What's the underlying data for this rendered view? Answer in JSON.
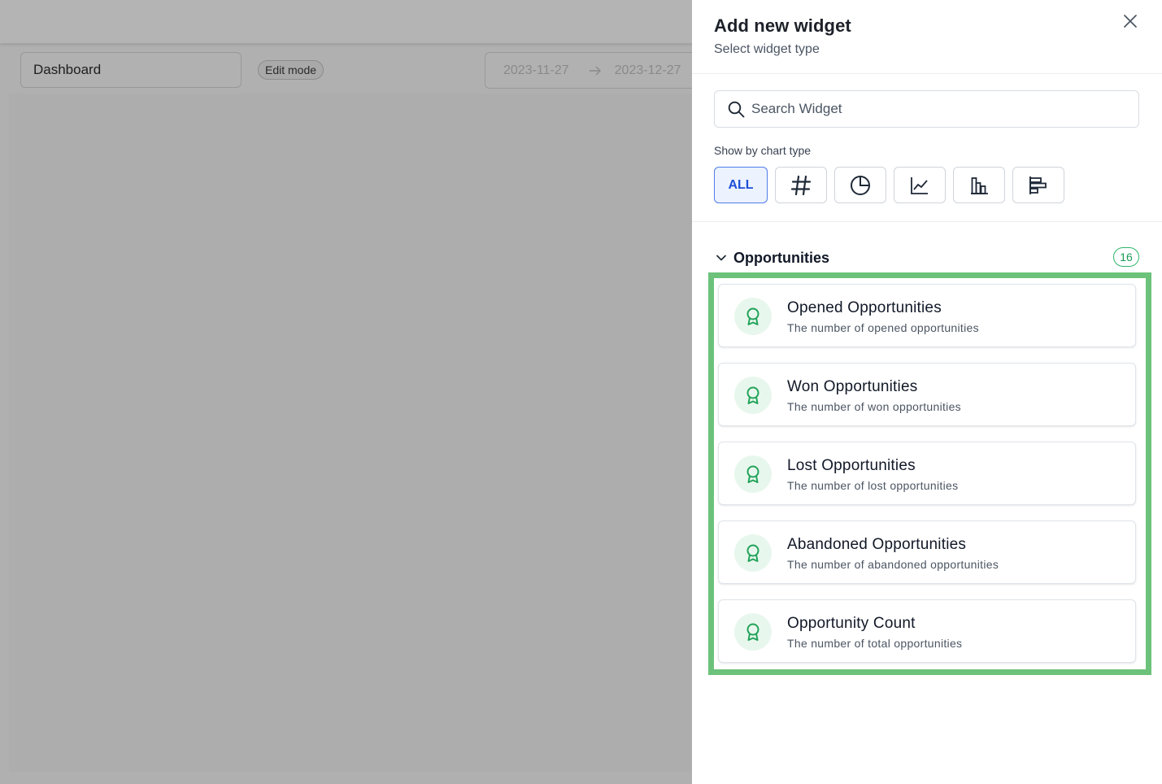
{
  "background": {
    "dashboard_select": "Dashboard",
    "edit_mode_badge": "Edit mode",
    "date_start": "2023-11-27",
    "date_end": "2023-12-27"
  },
  "drawer": {
    "title": "Add new widget",
    "subtitle": "Select widget type",
    "close_icon": "close-icon",
    "search": {
      "placeholder": "Search Widget",
      "value": "",
      "icon": "search-icon"
    },
    "filter_label": "Show by chart type",
    "filters": [
      {
        "label": "ALL",
        "icon": null,
        "active": true
      },
      {
        "label": "",
        "icon": "hash-icon",
        "active": false
      },
      {
        "label": "",
        "icon": "pie-chart-icon",
        "active": false
      },
      {
        "label": "",
        "icon": "line-chart-icon",
        "active": false
      },
      {
        "label": "",
        "icon": "bar-chart-icon",
        "active": false
      },
      {
        "label": "",
        "icon": "horizontal-bar-chart-icon",
        "active": false
      }
    ],
    "group": {
      "title": "Opportunities",
      "count": "16",
      "expanded": true,
      "items": [
        {
          "title": "Opened Opportunities",
          "description": "The number of opened opportunities",
          "icon": "award-icon"
        },
        {
          "title": "Won Opportunities",
          "description": "The number of won opportunities",
          "icon": "award-icon"
        },
        {
          "title": "Lost Opportunities",
          "description": "The number of lost opportunities",
          "icon": "award-icon"
        },
        {
          "title": "Abandoned Opportunities",
          "description": "The number of abandoned opportunities",
          "icon": "award-icon"
        },
        {
          "title": "Opportunity Count",
          "description": "The number of total opportunities",
          "icon": "award-icon"
        }
      ]
    }
  },
  "colors": {
    "accent": "#1e4fd6",
    "success": "#2fb56a",
    "highlight": "#6cc27a"
  }
}
